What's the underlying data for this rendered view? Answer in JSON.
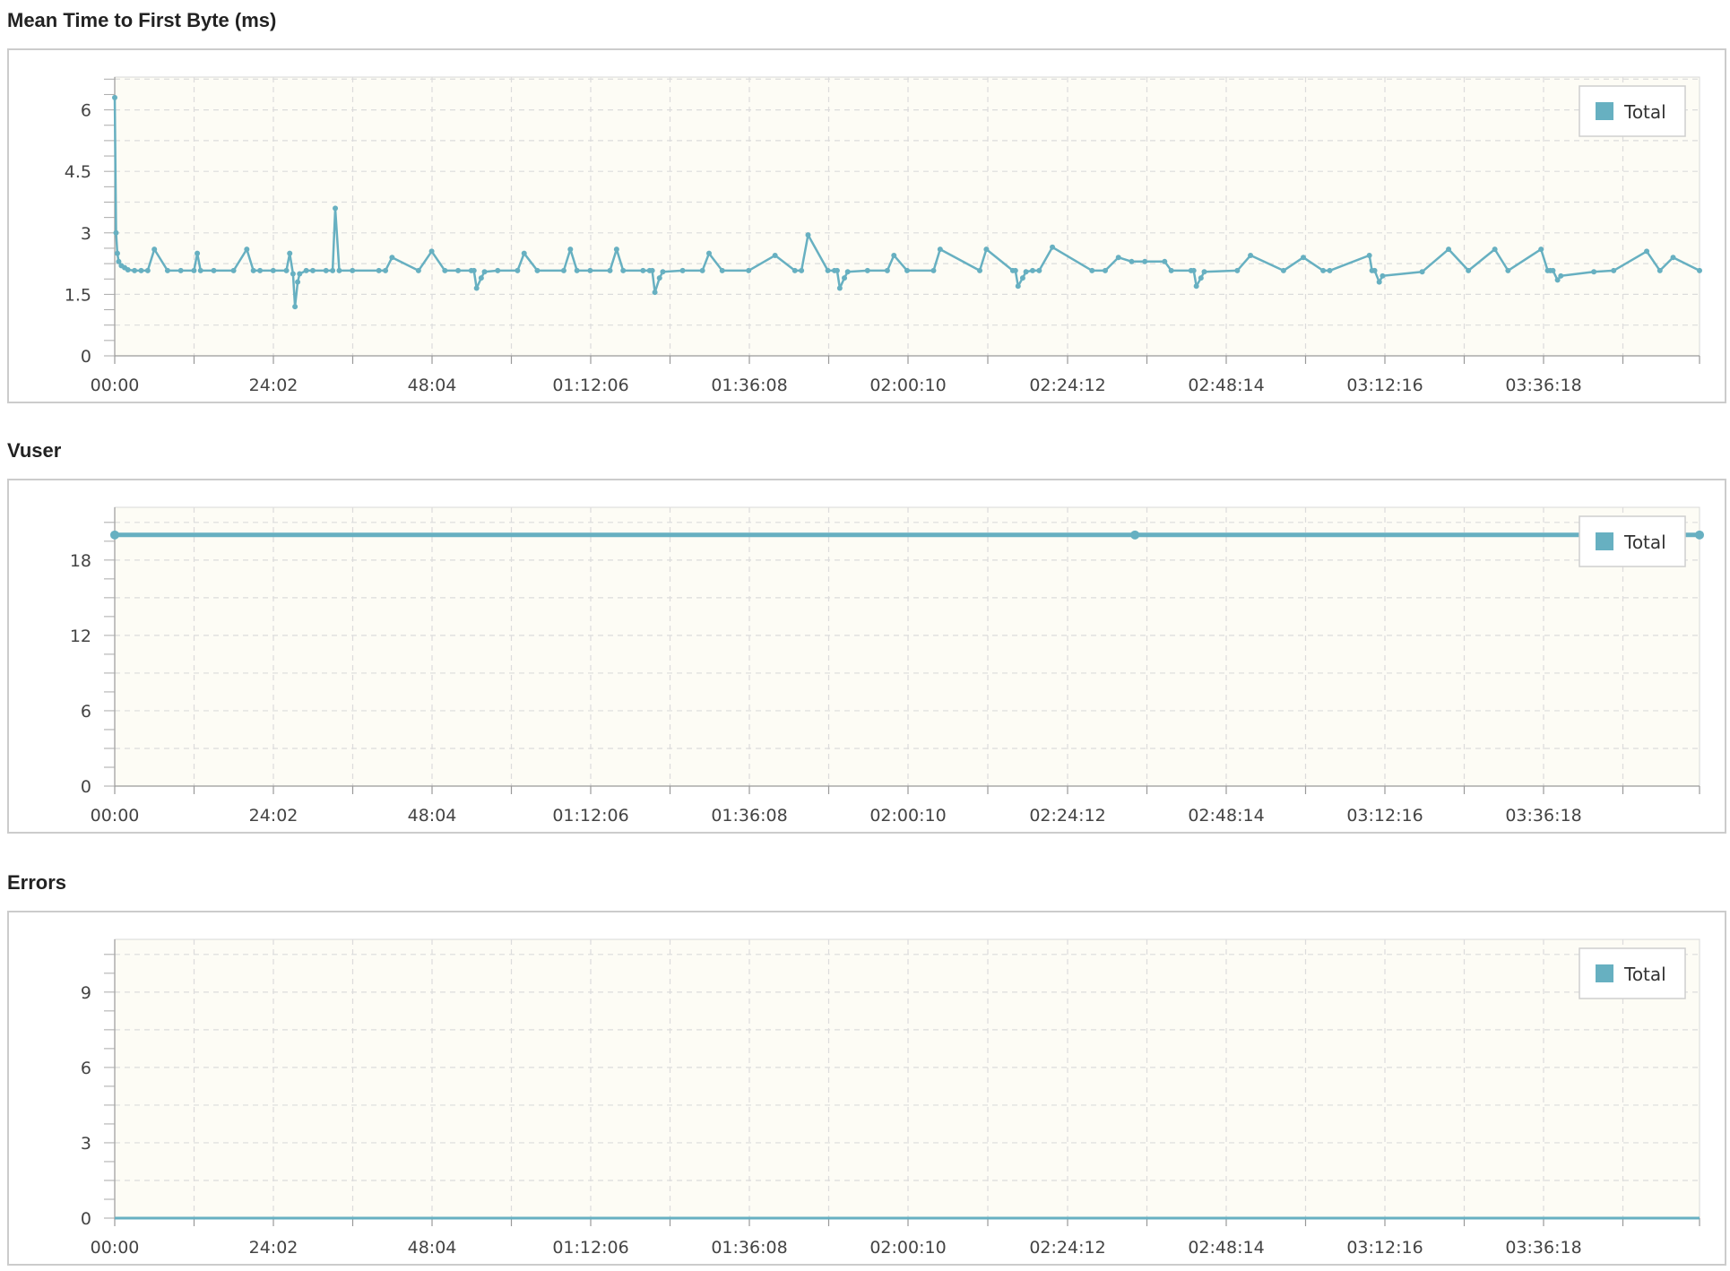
{
  "colors": {
    "series": "#67b0c1",
    "plot_bg": "#fdfcf5",
    "grid": "#dcdcdc"
  },
  "chart_data": [
    {
      "type": "line",
      "title": "Mean Time to First Byte (ms)",
      "legend": "top-right",
      "grid": true,
      "x_tick_labels": [
        "00:00",
        "24:02",
        "48:04",
        "01:12:06",
        "01:36:08",
        "02:00:10",
        "02:24:12",
        "02:48:14",
        "03:12:16",
        "03:36:18"
      ],
      "y_ticks": [
        0,
        1.5,
        3,
        4.5,
        6
      ],
      "y_tick_labels": [
        "0",
        "1.5",
        "3",
        "4.5",
        "6"
      ],
      "ylim": [
        0,
        6.8
      ],
      "xlim_minutes": [
        0,
        240
      ],
      "series": [
        {
          "name": "Total",
          "x_minutes": [
            0,
            0.2,
            0.4,
            0.6,
            1.0,
            1.5,
            2,
            3,
            4,
            5,
            6,
            8,
            10,
            12,
            12.5,
            13,
            15,
            18,
            20,
            21,
            22,
            24,
            26,
            26.5,
            27,
            27.3,
            27.7,
            28,
            29,
            30,
            32,
            33,
            33.4,
            34,
            36,
            40,
            41,
            42,
            46,
            48,
            50,
            52,
            54,
            54.4,
            54.8,
            55.5,
            56,
            58,
            61,
            62,
            64,
            68,
            69,
            70,
            72,
            75,
            76,
            77,
            80,
            81,
            81.4,
            81.8,
            82.5,
            83,
            86,
            89,
            90,
            92,
            96,
            100,
            103,
            104,
            105,
            108,
            109,
            109.4,
            109.8,
            110.5,
            111,
            114,
            117,
            118,
            120,
            124,
            125,
            131,
            132,
            136,
            136.4,
            136.8,
            137.5,
            138,
            139,
            140,
            142,
            148,
            150,
            152,
            154,
            156,
            159,
            160,
            163,
            163.4,
            163.8,
            164.5,
            165,
            170,
            172,
            177,
            180,
            183,
            184,
            190,
            190.4,
            190.8,
            191.5,
            192,
            198,
            202,
            205,
            209,
            211,
            216,
            217,
            217.4,
            217.8,
            218.5,
            219,
            224,
            227,
            232,
            234,
            236,
            240
          ],
          "values": [
            6.3,
            3.0,
            2.5,
            2.3,
            2.2,
            2.15,
            2.1,
            2.08,
            2.08,
            2.08,
            2.6,
            2.08,
            2.08,
            2.08,
            2.5,
            2.08,
            2.08,
            2.08,
            2.6,
            2.08,
            2.08,
            2.08,
            2.08,
            2.5,
            2.0,
            1.2,
            1.8,
            2.0,
            2.08,
            2.08,
            2.08,
            2.08,
            3.6,
            2.08,
            2.08,
            2.08,
            2.08,
            2.4,
            2.08,
            2.55,
            2.08,
            2.08,
            2.08,
            2.08,
            1.65,
            1.9,
            2.05,
            2.08,
            2.08,
            2.5,
            2.08,
            2.08,
            2.6,
            2.08,
            2.08,
            2.08,
            2.6,
            2.08,
            2.08,
            2.08,
            2.08,
            1.55,
            1.9,
            2.05,
            2.08,
            2.08,
            2.5,
            2.08,
            2.08,
            2.45,
            2.08,
            2.08,
            2.95,
            2.08,
            2.08,
            2.08,
            1.65,
            1.9,
            2.05,
            2.08,
            2.08,
            2.45,
            2.08,
            2.08,
            2.6,
            2.08,
            2.6,
            2.08,
            2.08,
            1.7,
            1.9,
            2.05,
            2.08,
            2.08,
            2.65,
            2.08,
            2.08,
            2.4,
            2.3,
            2.3,
            2.3,
            2.08,
            2.08,
            2.08,
            1.7,
            1.9,
            2.05,
            2.08,
            2.45,
            2.08,
            2.4,
            2.08,
            2.08,
            2.45,
            2.08,
            2.08,
            1.8,
            1.95,
            2.05,
            2.6,
            2.08,
            2.6,
            2.08,
            2.6,
            2.08,
            2.08,
            2.08,
            1.85,
            1.95,
            2.05,
            2.08,
            2.55,
            2.08,
            2.4,
            2.08,
            2.6,
            2.08,
            2.08
          ]
        }
      ]
    },
    {
      "type": "line",
      "title": "Vuser",
      "legend": "top-right",
      "grid": true,
      "x_tick_labels": [
        "00:00",
        "24:02",
        "48:04",
        "01:12:06",
        "01:36:08",
        "02:00:10",
        "02:24:12",
        "02:48:14",
        "03:12:16",
        "03:36:18"
      ],
      "y_ticks": [
        0,
        6,
        12,
        18
      ],
      "y_tick_labels": [
        "0",
        "6",
        "12",
        "18"
      ],
      "ylim": [
        0,
        22.2
      ],
      "xlim_minutes": [
        0,
        240
      ],
      "series": [
        {
          "name": "Total",
          "x_minutes": [
            0,
            154.5,
            240
          ],
          "values": [
            20,
            20,
            20
          ]
        }
      ]
    },
    {
      "type": "line",
      "title": "Errors",
      "legend": "top-right",
      "grid": true,
      "x_tick_labels": [
        "00:00",
        "24:02",
        "48:04",
        "01:12:06",
        "01:36:08",
        "02:00:10",
        "02:24:12",
        "02:48:14",
        "03:12:16",
        "03:36:18"
      ],
      "y_ticks": [
        0,
        3,
        6,
        9
      ],
      "y_tick_labels": [
        "0",
        "3",
        "6",
        "9"
      ],
      "ylim": [
        0,
        11.1
      ],
      "xlim_minutes": [
        0,
        240
      ],
      "series": [
        {
          "name": "Total",
          "x_minutes": [
            0,
            240
          ],
          "values": [
            0,
            0
          ]
        }
      ]
    }
  ]
}
